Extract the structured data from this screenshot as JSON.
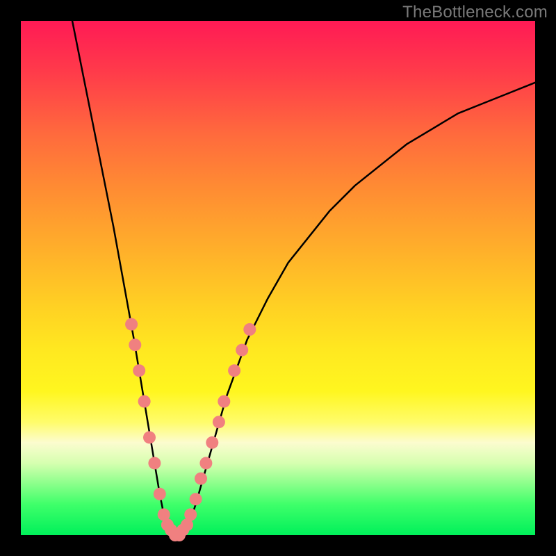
{
  "watermark": "TheBottleneck.com",
  "chart_data": {
    "type": "line",
    "title": "",
    "xlabel": "",
    "ylabel": "",
    "xlim": [
      0,
      100
    ],
    "ylim": [
      0,
      100
    ],
    "grid": false,
    "legend": false,
    "series": [
      {
        "name": "bottleneck-curve",
        "color": "#000000",
        "x": [
          10,
          12,
          14,
          16,
          18,
          20,
          22,
          23,
          24,
          25,
          26,
          27,
          28,
          29,
          30,
          31,
          32,
          33,
          34,
          36,
          38,
          40,
          44,
          48,
          52,
          56,
          60,
          65,
          70,
          75,
          80,
          85,
          90,
          95,
          100
        ],
        "y": [
          100,
          90,
          80,
          70,
          60,
          49,
          38,
          32,
          26,
          20,
          14,
          8,
          3,
          1,
          0,
          0,
          1,
          3,
          6,
          13,
          20,
          27,
          38,
          46,
          53,
          58,
          63,
          68,
          72,
          76,
          79,
          82,
          84,
          86,
          88
        ]
      }
    ],
    "scatter": {
      "name": "data-points",
      "color": "#f08080",
      "radius": 9,
      "points": [
        {
          "x": 21.5,
          "y": 41
        },
        {
          "x": 22.2,
          "y": 37
        },
        {
          "x": 23.0,
          "y": 32
        },
        {
          "x": 24.0,
          "y": 26
        },
        {
          "x": 25.0,
          "y": 19
        },
        {
          "x": 26.0,
          "y": 14
        },
        {
          "x": 27.0,
          "y": 8
        },
        {
          "x": 27.8,
          "y": 4
        },
        {
          "x": 28.5,
          "y": 2
        },
        {
          "x": 29.2,
          "y": 1
        },
        {
          "x": 30.0,
          "y": 0
        },
        {
          "x": 30.8,
          "y": 0
        },
        {
          "x": 31.5,
          "y": 1
        },
        {
          "x": 32.3,
          "y": 2
        },
        {
          "x": 33.0,
          "y": 4
        },
        {
          "x": 34.0,
          "y": 7
        },
        {
          "x": 35.0,
          "y": 11
        },
        {
          "x": 36.0,
          "y": 14
        },
        {
          "x": 37.2,
          "y": 18
        },
        {
          "x": 38.5,
          "y": 22
        },
        {
          "x": 39.5,
          "y": 26
        },
        {
          "x": 41.5,
          "y": 32
        },
        {
          "x": 43.0,
          "y": 36
        },
        {
          "x": 44.5,
          "y": 40
        }
      ]
    },
    "background_gradient": {
      "direction": "vertical",
      "stops": [
        {
          "pos": 0,
          "color": "#ff1a55"
        },
        {
          "pos": 10,
          "color": "#ff3b4a"
        },
        {
          "pos": 22,
          "color": "#ff6a3d"
        },
        {
          "pos": 32,
          "color": "#ff8a33"
        },
        {
          "pos": 45,
          "color": "#ffb12a"
        },
        {
          "pos": 56,
          "color": "#ffd223"
        },
        {
          "pos": 64,
          "color": "#ffe820"
        },
        {
          "pos": 72,
          "color": "#fff61f"
        },
        {
          "pos": 78,
          "color": "#fffc6a"
        },
        {
          "pos": 82,
          "color": "#fcfccf"
        },
        {
          "pos": 86,
          "color": "#d6ffb0"
        },
        {
          "pos": 90,
          "color": "#8bff8b"
        },
        {
          "pos": 94,
          "color": "#3fff6a"
        },
        {
          "pos": 100,
          "color": "#00f05a"
        }
      ]
    }
  }
}
